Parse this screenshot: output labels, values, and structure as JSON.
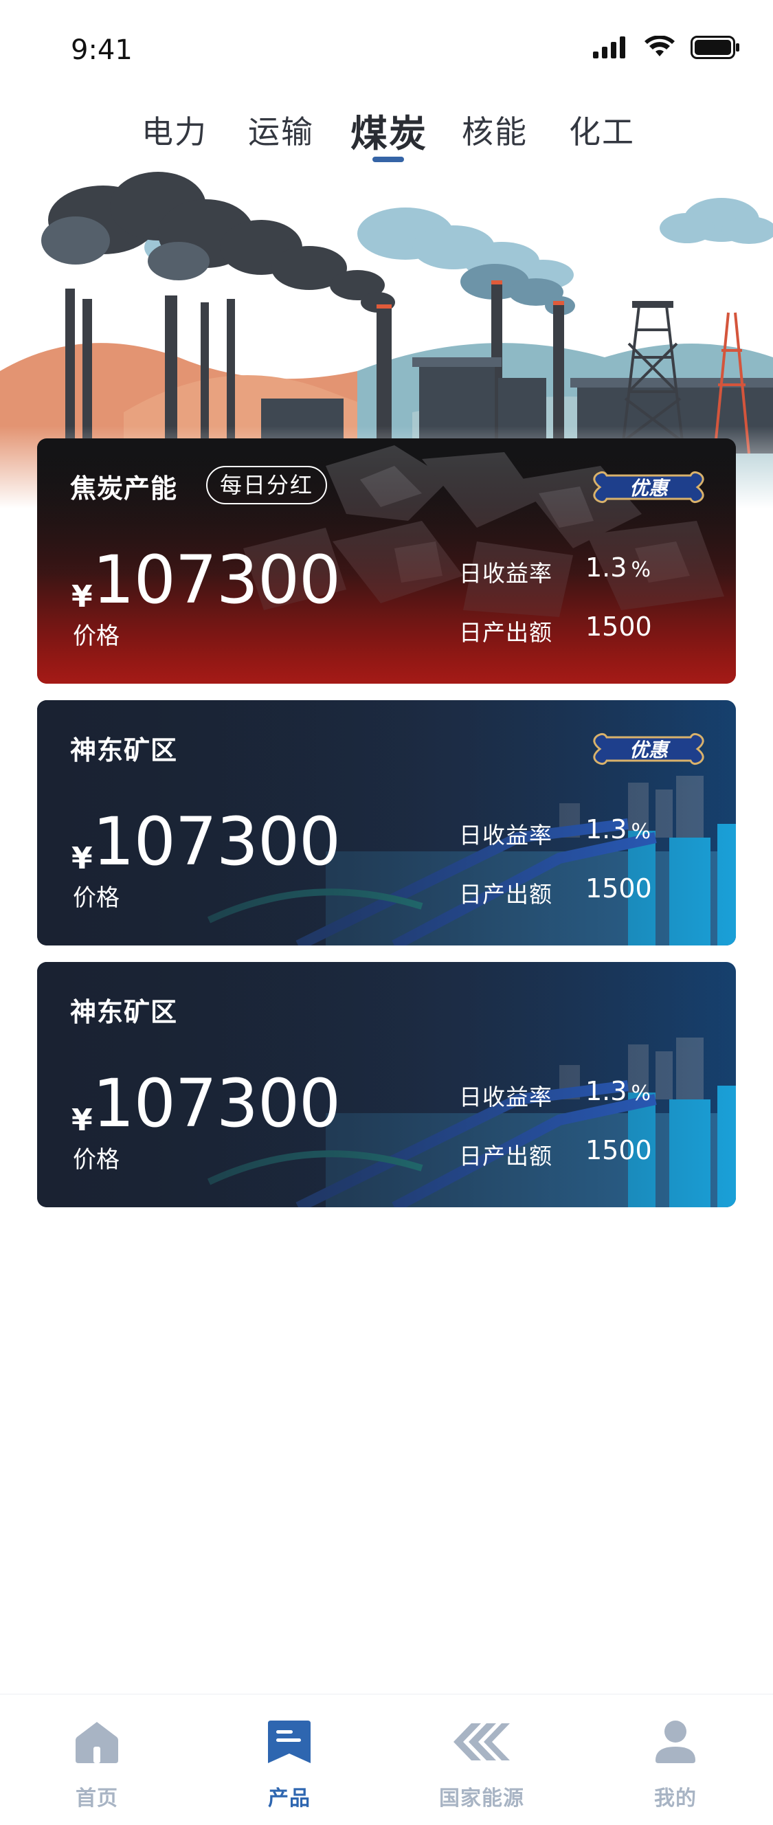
{
  "status_bar": {
    "time": "9:41"
  },
  "tabs": [
    {
      "label": "电力",
      "active": false
    },
    {
      "label": "运输",
      "active": false
    },
    {
      "label": "煤炭",
      "active": true
    },
    {
      "label": "核能",
      "active": false
    },
    {
      "label": "化工",
      "active": false
    }
  ],
  "cards": [
    {
      "title": "焦炭产能",
      "tag": "每日分红",
      "badge": "优惠",
      "currency": "¥",
      "price": "107300",
      "price_label": "价格",
      "yield_label": "日收益率",
      "yield_value": "1.3",
      "yield_unit": "%",
      "output_label": "日产出额",
      "output_value": "1500"
    },
    {
      "title": "神东矿区",
      "badge": "优惠",
      "currency": "¥",
      "price": "107300",
      "price_label": "价格",
      "yield_label": "日收益率",
      "yield_value": "1.3",
      "yield_unit": "%",
      "output_label": "日产出额",
      "output_value": "1500"
    },
    {
      "title": "神东矿区",
      "currency": "¥",
      "price": "107300",
      "price_label": "价格",
      "yield_label": "日收益率",
      "yield_value": "1.3",
      "yield_unit": "%",
      "output_label": "日产出额",
      "output_value": "1500"
    }
  ],
  "bottom_nav": [
    {
      "label": "首页",
      "icon": "home-icon",
      "active": false
    },
    {
      "label": "产品",
      "icon": "product-icon",
      "active": true
    },
    {
      "label": "国家能源",
      "icon": "energy-logo-icon",
      "active": false
    },
    {
      "label": "我的",
      "icon": "profile-icon",
      "active": false
    }
  ],
  "colors": {
    "accent": "#2e66b0",
    "nav_inactive": "#a8b4c4",
    "card_red": "#a51c1c",
    "card_navy": "#1b2a44"
  }
}
